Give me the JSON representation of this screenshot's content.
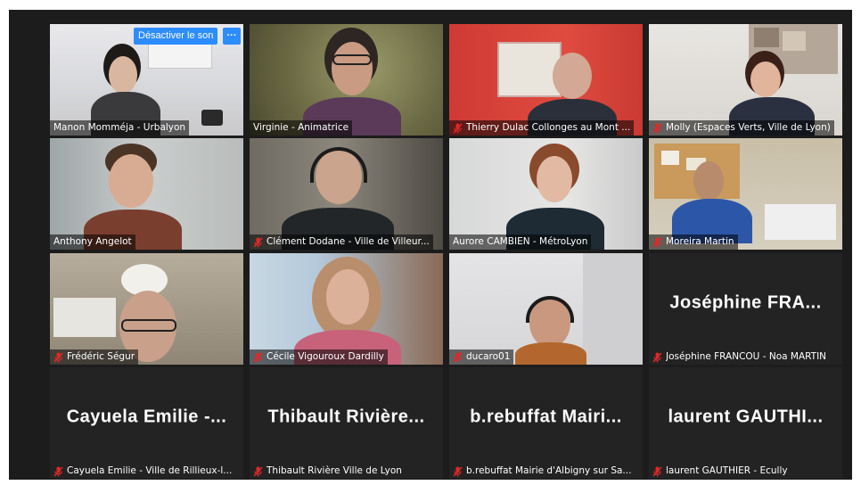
{
  "tooltip": {
    "mute_label": "Désactiver le son",
    "more_label": "···"
  },
  "participants": [
    {
      "name": "Manon Momméja - Urbalyon",
      "display": "",
      "muted": false
    },
    {
      "name": "Virginie - Animatrice",
      "display": "",
      "muted": false,
      "active_speaker": true
    },
    {
      "name": "Thierry Dulac Collonges au Mont ...",
      "display": "",
      "muted": true
    },
    {
      "name": "Molly (Espaces Verts, Ville de Lyon)",
      "display": "",
      "muted": true
    },
    {
      "name": "Anthony Angelot",
      "display": "",
      "muted": false
    },
    {
      "name": "Clément Dodane - Ville de Villeur...",
      "display": "",
      "muted": true
    },
    {
      "name": "Aurore CAMBIEN - MétroLyon",
      "display": "",
      "muted": false
    },
    {
      "name": "Moreira Martin",
      "display": "",
      "muted": true
    },
    {
      "name": "Frédéric Ségur",
      "display": "",
      "muted": true
    },
    {
      "name": "Cécile Vigouroux Dardilly",
      "display": "",
      "muted": true
    },
    {
      "name": "ducaro01",
      "display": "",
      "muted": true
    },
    {
      "name": "Joséphine FRANCOU - Noa MARTIN",
      "display": "Joséphine  FRA...",
      "muted": true
    },
    {
      "name": "Cayuela Emilie - Ville de Rillieux-l...",
      "display": "Cayuela  Emilie  -...",
      "muted": true
    },
    {
      "name": "Thibault Rivière Ville de Lyon",
      "display": "Thibault  Rivière...",
      "muted": true
    },
    {
      "name": "b.rebuffat Mairie d'Albigny sur Sa...",
      "display": "b.rebuffat  Mairi...",
      "muted": true
    },
    {
      "name": "laurent GAUTHIER - Ecully",
      "display": "laurent  GAUTHI...",
      "muted": true
    }
  ],
  "colors": {
    "background": "#1c1c1c",
    "active_speaker_border": "#d7e37a",
    "muted_icon": "#e02828",
    "button_blue": "#2d8cff"
  },
  "icons": {
    "muted": "microphone-muted-icon"
  }
}
